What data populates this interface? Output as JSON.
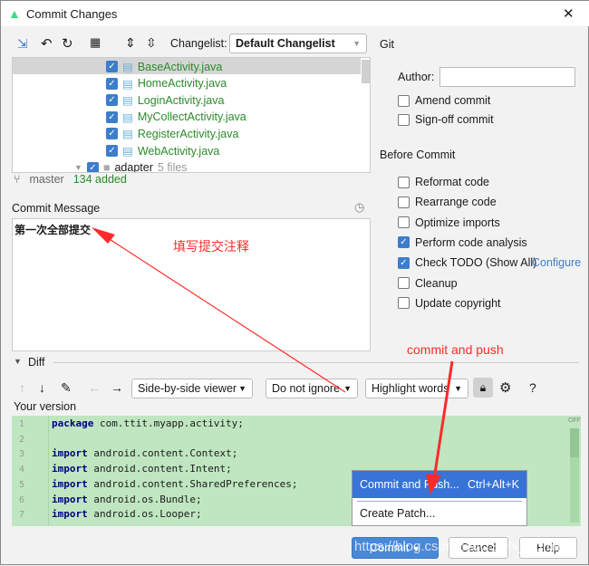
{
  "window": {
    "title": "Commit Changes",
    "close": "✕"
  },
  "toolbar": {
    "changelist_label": "Changelist:",
    "changelist_value": "Default Changelist"
  },
  "files": [
    {
      "name": "BaseActivity.java",
      "checked": true
    },
    {
      "name": "HomeActivity.java",
      "checked": true
    },
    {
      "name": "LoginActivity.java",
      "checked": true
    },
    {
      "name": "MyCollectActivity.java",
      "checked": true
    },
    {
      "name": "RegisterActivity.java",
      "checked": true
    },
    {
      "name": "WebActivity.java",
      "checked": true
    }
  ],
  "folder": {
    "name": "adapter",
    "count": "5 files"
  },
  "status": {
    "branch": "master",
    "added": "134 added"
  },
  "commit_message": {
    "label": "Commit Message",
    "value": "第一次全部提交"
  },
  "git": {
    "header": "Git",
    "author_label": "Author:",
    "author_value": "",
    "amend": "Amend commit",
    "signoff": "Sign-off commit"
  },
  "before_commit": {
    "header": "Before Commit",
    "options": [
      {
        "label": "Reformat code",
        "checked": false
      },
      {
        "label": "Rearrange code",
        "checked": false
      },
      {
        "label": "Optimize imports",
        "checked": false
      },
      {
        "label": "Perform code analysis",
        "checked": true
      },
      {
        "label": "Check TODO (Show All)",
        "checked": true
      },
      {
        "label": "Cleanup",
        "checked": false
      },
      {
        "label": "Update copyright",
        "checked": false
      }
    ],
    "configure": "Configure"
  },
  "diff": {
    "header": "Diff",
    "viewer": "Side-by-side viewer",
    "ignore": "Do not ignore",
    "highlight": "Highlight words",
    "help": "?",
    "your_version": "Your version",
    "off": "OFF",
    "lines": [
      {
        "n": "1",
        "kw": "package",
        "rest": " com.ttit.myapp.activity;"
      },
      {
        "n": "2",
        "kw": "",
        "rest": ""
      },
      {
        "n": "3",
        "kw": "import",
        "rest": " android.content.Context;"
      },
      {
        "n": "4",
        "kw": "import",
        "rest": " android.content.Intent;"
      },
      {
        "n": "5",
        "kw": "import",
        "rest": " android.content.SharedPreferences;"
      },
      {
        "n": "6",
        "kw": "import",
        "rest": " android.os.Bundle;"
      },
      {
        "n": "7",
        "kw": "import",
        "rest": " android.os.Looper;"
      }
    ]
  },
  "popup": {
    "commit_push": "Commit and Push...",
    "shortcut": "Ctrl+Alt+K",
    "create_patch": "Create Patch..."
  },
  "buttons": {
    "commit": "Commit",
    "cancel": "Cancel",
    "help": "Help"
  },
  "annotations": {
    "note1": "填写提交注释",
    "note2": "commit  and push",
    "color": "#ff2a2a"
  },
  "watermark": "https://blog.csdn.net/CSDN_Admin0"
}
